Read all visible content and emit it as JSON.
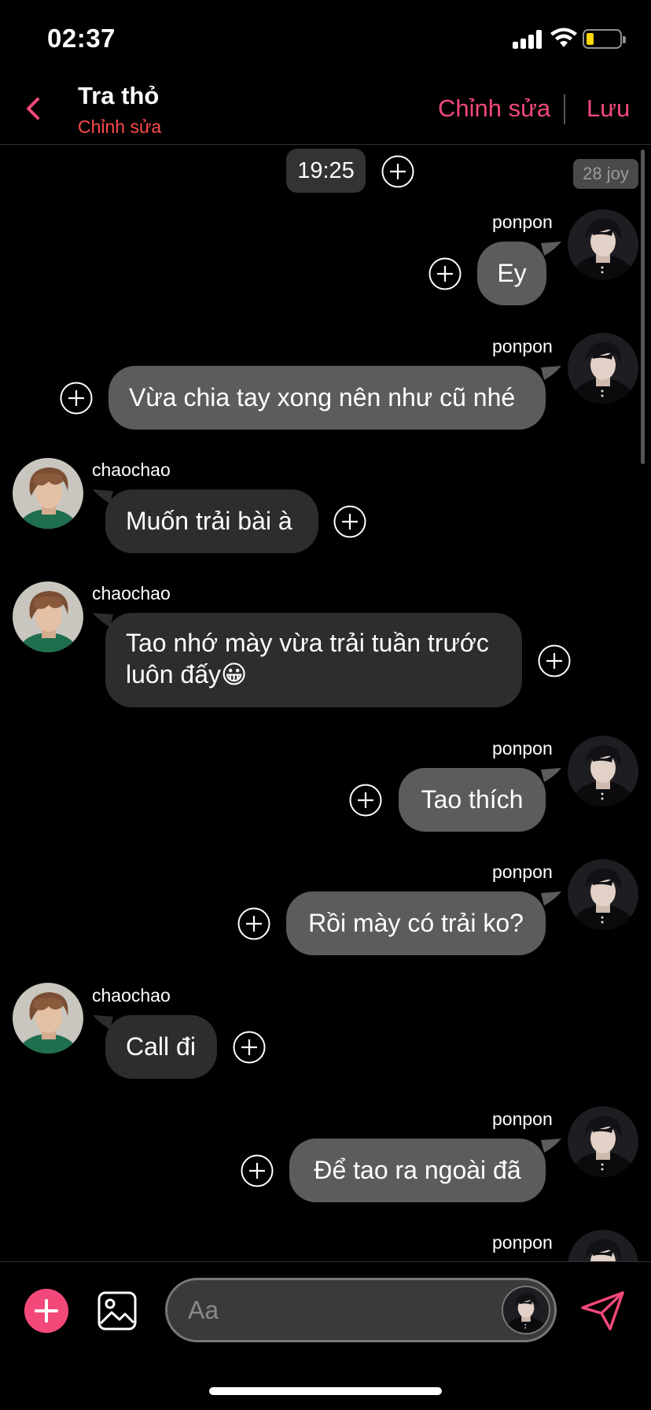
{
  "status_bar": {
    "time": "02:37"
  },
  "header": {
    "title": "Tra thỏ",
    "subtitle": "Chỉnh sửa",
    "edit_label": "Chỉnh sửa",
    "save_label": "Lưu"
  },
  "chat": {
    "time_chip": "19:25",
    "date_chip": "28 joy",
    "messages": [
      {
        "sender": "ponpon",
        "side": "sent",
        "text": "Ey"
      },
      {
        "sender": "ponpon",
        "side": "sent",
        "text": "Vừa chia tay xong nên như cũ nhé"
      },
      {
        "sender": "chaochao",
        "side": "recv",
        "text": "Muốn trải bài à"
      },
      {
        "sender": "chaochao",
        "side": "recv",
        "line1": "Tao nhớ mày vừa trải tuần trước",
        "line2": "luôn đấy",
        "emoji": "😀"
      },
      {
        "sender": "ponpon",
        "side": "sent",
        "text": "Tao thích"
      },
      {
        "sender": "ponpon",
        "side": "sent",
        "text": "Rồi mày có trải ko?"
      },
      {
        "sender": "chaochao",
        "side": "recv",
        "text": "Call đi"
      },
      {
        "sender": "ponpon",
        "side": "sent",
        "text": "Để tao ra ngoài đã"
      },
      {
        "sender": "ponpon",
        "side": "sent",
        "text": ""
      }
    ]
  },
  "composer": {
    "placeholder": "Aa"
  },
  "colors": {
    "accent": "#f2497a",
    "subtitle": "#ff4b4b",
    "sent_bubble": "#5c5c5c",
    "recv_bubble": "#2d2d2d"
  },
  "icons": [
    "back-chevron-icon",
    "plus-circle-icon",
    "image-icon",
    "send-icon",
    "signal-icon",
    "wifi-icon",
    "battery-icon"
  ]
}
